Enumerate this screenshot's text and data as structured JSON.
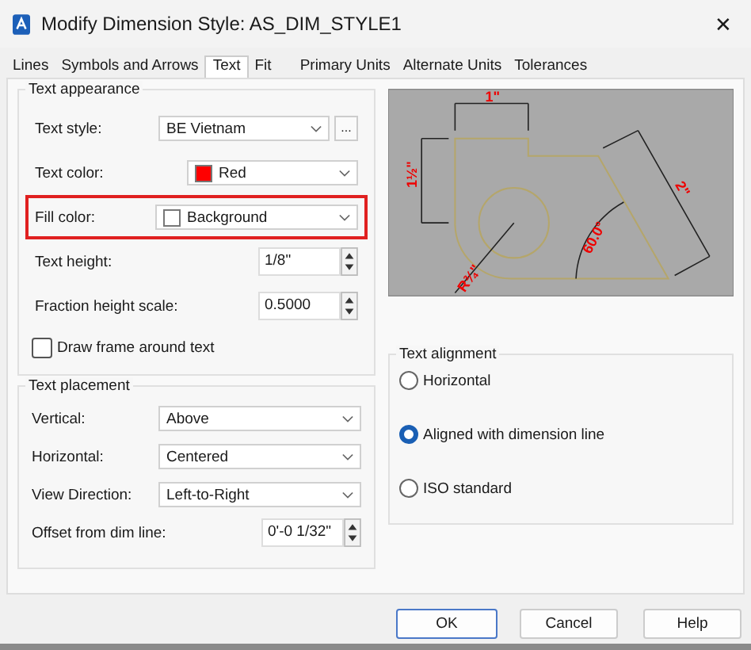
{
  "window": {
    "title": "Modify Dimension Style: AS_DIM_STYLE1",
    "close": "✕"
  },
  "tabs": [
    {
      "label": "Lines",
      "selected": false
    },
    {
      "label": "Symbols and Arrows",
      "selected": false
    },
    {
      "label": "Text",
      "selected": true
    },
    {
      "label": "Fit",
      "selected": false
    },
    {
      "label": "Primary Units",
      "selected": false
    },
    {
      "label": "Alternate Units",
      "selected": false
    },
    {
      "label": "Tolerances",
      "selected": false
    }
  ],
  "text_appearance": {
    "title": "Text appearance",
    "rows": [
      {
        "kind": "select",
        "label": "Text style:",
        "value": "BE Vietnam",
        "button": "...",
        "highlighted": false
      },
      {
        "kind": "color",
        "label": "Text color:",
        "value": "Red",
        "color": "#ff0000",
        "highlighted": false
      },
      {
        "kind": "color",
        "label": "Fill color:",
        "value": "Background",
        "color": "#ffffff",
        "highlighted": true
      },
      {
        "kind": "spin",
        "label": "Text height:",
        "value": "1/8\"",
        "highlighted": false
      },
      {
        "kind": "spin",
        "label": "Fraction height scale:",
        "value": "0.5000",
        "highlighted": false
      },
      {
        "kind": "check",
        "label": "Draw frame around text",
        "checked": false,
        "highlighted": false
      }
    ]
  },
  "text_placement": {
    "title": "Text placement",
    "rows": [
      {
        "kind": "select",
        "label": "Vertical:",
        "value": "Above"
      },
      {
        "kind": "select",
        "label": "Horizontal:",
        "value": "Centered"
      },
      {
        "kind": "select",
        "label": "View Direction:",
        "value": "Left-to-Right"
      },
      {
        "kind": "spin",
        "label": "Offset from dim line:",
        "value": "0'-0 1/32\""
      }
    ]
  },
  "preview": {
    "labels": [
      "1\"",
      "1½\"",
      "2\"",
      "60.0°",
      "R¾\""
    ]
  },
  "text_alignment": {
    "title": "Text alignment",
    "options": [
      {
        "label": "Horizontal",
        "selected": false
      },
      {
        "label": "Aligned with dimension line",
        "selected": true
      },
      {
        "label": "ISO standard",
        "selected": false
      }
    ]
  },
  "buttons": [
    {
      "label": "OK",
      "default": true
    },
    {
      "label": "Cancel",
      "default": false
    },
    {
      "label": "Help",
      "default": false
    }
  ]
}
